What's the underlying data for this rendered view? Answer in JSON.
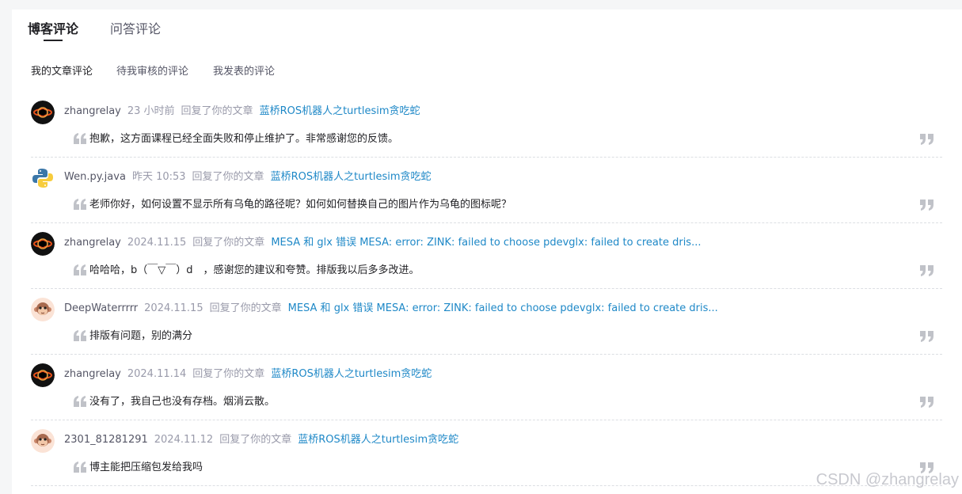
{
  "tabs": [
    "博客评论",
    "问答评论"
  ],
  "subtabs": [
    "我的文章评论",
    "待我审核的评论",
    "我发表的评论"
  ],
  "comments": [
    {
      "user": "zhangrelay",
      "time": "23 小时前",
      "action": "回复了你的文章",
      "article": "蓝桥ROS机器人之turtlesim贪吃蛇",
      "text": "抱歉，这方面课程已经全面失败和停止维护了。非常感谢您的反馈。",
      "avatar": "black-hole"
    },
    {
      "user": "Wen.py.java",
      "time": "昨天 10:53",
      "action": "回复了你的文章",
      "article": "蓝桥ROS机器人之turtlesim贪吃蛇",
      "text": "老师你好，如何设置不显示所有乌龟的路径呢？如何如何替换自己的图片作为乌龟的图标呢？",
      "avatar": "python"
    },
    {
      "user": "zhangrelay",
      "time": "2024.11.15",
      "action": "回复了你的文章",
      "article": "MESA 和 glx 错误 MESA: error: ZINK: failed to choose pdevglx: failed to create dris...",
      "text": "哈哈哈，b（￣▽￣）d　，感谢您的建议和夸赞。排版我以后多多改进。",
      "avatar": "black-hole"
    },
    {
      "user": "DeepWaterrrrr",
      "time": "2024.11.15",
      "action": "回复了你的文章",
      "article": "MESA 和 glx 错误 MESA: error: ZINK: failed to choose pdevglx: failed to create dris...",
      "text": "排版有问题，别的满分",
      "avatar": "monkey"
    },
    {
      "user": "zhangrelay",
      "time": "2024.11.14",
      "action": "回复了你的文章",
      "article": "蓝桥ROS机器人之turtlesim贪吃蛇",
      "text": "没有了，我自己也没有存档。烟消云散。",
      "avatar": "black-hole"
    },
    {
      "user": "2301_81281291",
      "time": "2024.11.12",
      "action": "回复了你的文章",
      "article": "蓝桥ROS机器人之turtlesim贪吃蛇",
      "text": "博主能把压缩包发给我吗",
      "avatar": "monkey"
    }
  ],
  "watermark": "CSDN @zhangrelay",
  "colors": {
    "link": "#1e88c7",
    "muted": "#999aaa",
    "divider": "#dcdee3"
  }
}
